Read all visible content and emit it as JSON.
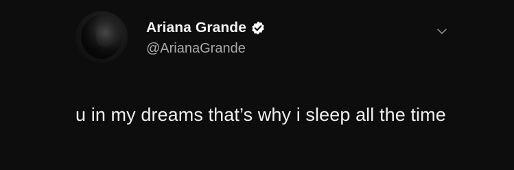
{
  "tweet": {
    "author": {
      "display_name": "Ariana Grande",
      "handle": "@ArianaGrande",
      "verified": true,
      "avatar_icon": "profile-photo"
    },
    "menu_icon": "chevron-down-icon",
    "text": "u in my dreams that’s why i sleep all the time"
  },
  "colors": {
    "background": "#0d0d0d",
    "name_text": "#f2f2f2",
    "handle_text": "#a9a9a9",
    "body_text": "#f0f0f0",
    "verified_badge": "#ffffff"
  }
}
